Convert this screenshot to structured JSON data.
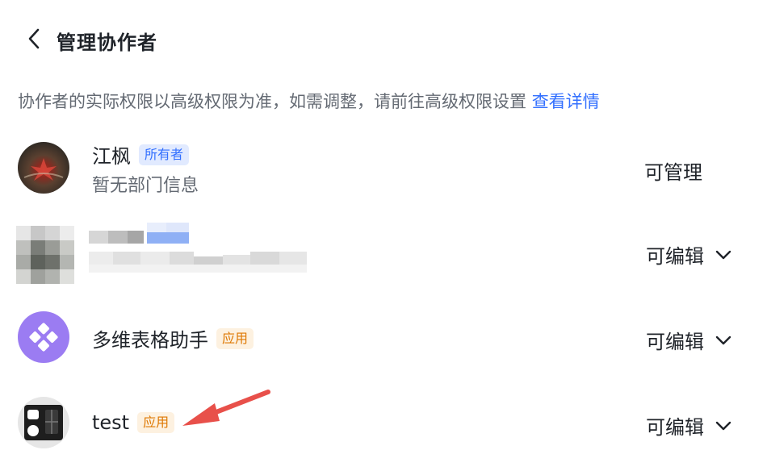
{
  "header": {
    "title": "管理协作者",
    "back_icon": "chevron-left-icon"
  },
  "notice": {
    "text": "协作者的实际权限以高级权限为准，如需调整，请前往高级权限设置",
    "link": "查看详情"
  },
  "colors": {
    "link": "#3370ff",
    "owner_badge_bg": "#e1eaff",
    "app_badge_bg": "#fdf1e0",
    "app_badge_text": "#de7802",
    "arrow": "#e8504a"
  },
  "collaborators": [
    {
      "name": "江枫",
      "badge": "所有者",
      "department": "暂无部门信息",
      "permission": "可管理"
    },
    {
      "name": "",
      "permission": "可编辑"
    },
    {
      "name": "多维表格助手",
      "badge": "应用",
      "permission": "可编辑"
    },
    {
      "name": "test",
      "badge": "应用",
      "permission": "可编辑"
    }
  ]
}
